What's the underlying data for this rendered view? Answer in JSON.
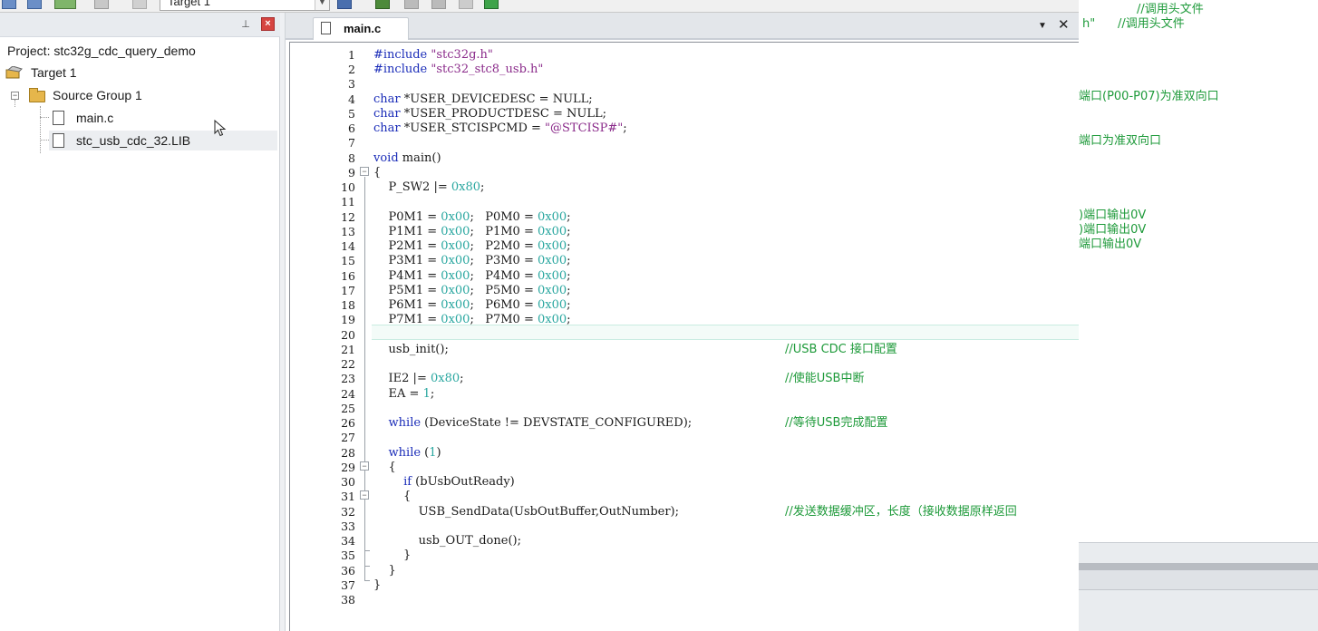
{
  "toolbar": {
    "target_select": "Target 1",
    "icons": [
      "save-icon",
      "save-all-icon",
      "build-icon",
      "batch-icon",
      "debug-icon",
      "options-icon",
      "manage-icon",
      "download-icon",
      "load-icon",
      "translate-icon",
      "flash-icon"
    ]
  },
  "project_panel": {
    "project_label": "Project: stc32g_cdc_query_demo",
    "target_label": "Target 1",
    "group_label": "Source Group 1",
    "files": [
      "main.c",
      "stc_usb_cdc_32.LIB"
    ]
  },
  "editor": {
    "tab_label": "main.c",
    "line_numbers": [
      "1",
      "2",
      "3",
      "4",
      "5",
      "6",
      "7",
      "8",
      "9",
      "10",
      "11",
      "12",
      "13",
      "14",
      "15",
      "16",
      "17",
      "18",
      "19",
      "20",
      "21",
      "22",
      "23",
      "24",
      "25",
      "26",
      "27",
      "28",
      "29",
      "30",
      "31",
      "32",
      "33",
      "34",
      "35",
      "36",
      "37",
      "38"
    ],
    "lines": {
      "l1": "#include \"stc32g.h\"",
      "l2": "#include \"stc32_stc8_usb.h\"",
      "l4": "char *USER_DEVICEDESC = NULL;",
      "l5": "char *USER_PRODUCTDESC = NULL;",
      "l6": "char *USER_STCISPCMD = \"@STCISP#\";",
      "l8": "void main()",
      "l9": "{",
      "l10": "    P_SW2 |= 0x80;",
      "l12": "    P0M1 = 0x00;   P0M0 = 0x00;",
      "l13": "    P1M1 = 0x00;   P1M0 = 0x00;",
      "l14": "    P2M1 = 0x00;   P2M0 = 0x00;",
      "l15": "    P3M1 = 0x00;   P3M0 = 0x00;",
      "l16": "    P4M1 = 0x00;   P4M0 = 0x00;",
      "l17": "    P5M1 = 0x00;   P5M0 = 0x00;",
      "l18": "    P6M1 = 0x00;   P6M0 = 0x00;",
      "l19": "    P7M1 = 0x00;   P7M0 = 0x00;",
      "l21": "    usb_init();",
      "l21c": "//USB CDC 接口配置",
      "l23": "    IE2 |= 0x80;",
      "l23c": "//使能USB中断",
      "l24": "    EA = 1;",
      "l26": "    while (DeviceState != DEVSTATE_CONFIGURED);",
      "l26c": "//等待USB完成配置",
      "l28": "    while (1)",
      "l29": "    {",
      "l30": "        if (bUsbOutReady)",
      "l31": "        {",
      "l32": "            USB_SendData(UsbOutBuffer,OutNumber);",
      "l32c": "//发送数据缓冲区，长度（接收数据原样返回",
      "l34": "            usb_OUT_done();",
      "l35": "        }",
      "l36": "    }",
      "l37": "}"
    }
  },
  "right_window": {
    "r1": "//调用头文件",
    "r2": "h\"      //调用头文件",
    "r3": "端口(P00-P07)为准双向口",
    "r4": "端口为准双向口",
    "r5": ")端口输出0V",
    "r6": ")端口输出0V",
    "r7": "端口输出0V"
  },
  "colors": {
    "keyword": "#1a2cb8",
    "string": "#8a2a8a",
    "number": "#2aa7a0",
    "comment": "#1e9a3a",
    "close_button": "#d64541"
  }
}
